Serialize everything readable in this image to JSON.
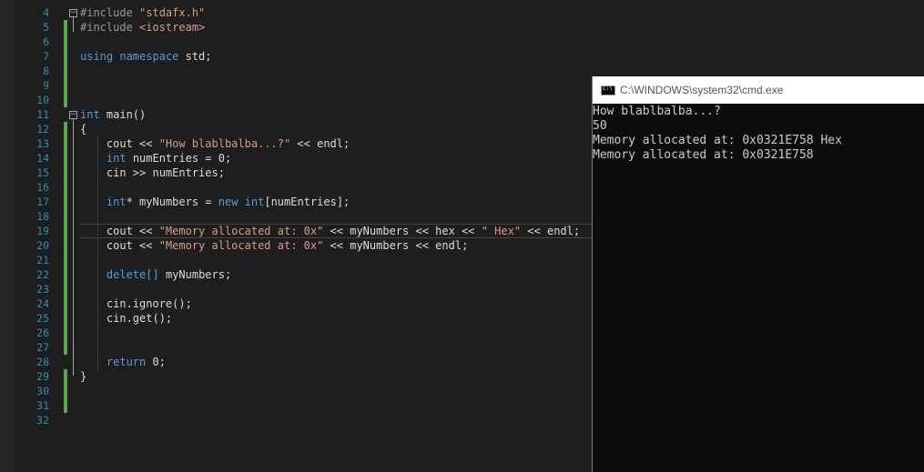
{
  "editor": {
    "line_numbers": [
      "4",
      "5",
      "6",
      "7",
      "8",
      "9",
      "10",
      "11",
      "12",
      "13",
      "14",
      "15",
      "16",
      "17",
      "18",
      "19",
      "20",
      "21",
      "22",
      "23",
      "24",
      "25",
      "26",
      "27",
      "28",
      "29",
      "30",
      "31",
      "32"
    ],
    "lines": [
      [
        {
          "t": "#include ",
          "c": "pp"
        },
        {
          "t": "\"stdafx.h\"",
          "c": "inc"
        }
      ],
      [
        {
          "t": "#include ",
          "c": "pp"
        },
        {
          "t": "<iostream>",
          "c": "inc"
        }
      ],
      [],
      [
        {
          "t": "using ",
          "c": "kw"
        },
        {
          "t": "namespace ",
          "c": "kw"
        },
        {
          "t": "std;",
          "c": "plain"
        }
      ],
      [],
      [],
      [],
      [
        {
          "t": "int ",
          "c": "kw"
        },
        {
          "t": "main()",
          "c": "plain"
        }
      ],
      [
        {
          "t": "{",
          "c": "plain"
        }
      ],
      [
        {
          "t": "    cout << ",
          "c": "plain"
        },
        {
          "t": "\"How blablbalba...?\"",
          "c": "str"
        },
        {
          "t": " << endl;",
          "c": "plain"
        }
      ],
      [
        {
          "t": "    ",
          "c": "plain"
        },
        {
          "t": "int ",
          "c": "kw"
        },
        {
          "t": "numEntries = 0;",
          "c": "plain"
        }
      ],
      [
        {
          "t": "    cin >> numEntries;",
          "c": "plain"
        }
      ],
      [],
      [
        {
          "t": "    ",
          "c": "plain"
        },
        {
          "t": "int",
          "c": "kw"
        },
        {
          "t": "* myNumbers = ",
          "c": "plain"
        },
        {
          "t": "new ",
          "c": "kw"
        },
        {
          "t": "int",
          "c": "kw"
        },
        {
          "t": "[numEntries];",
          "c": "plain"
        }
      ],
      [],
      [
        {
          "t": "    cout << ",
          "c": "plain"
        },
        {
          "t": "\"Memory allocated at: 0x\"",
          "c": "str"
        },
        {
          "t": " << myNumbers << hex << ",
          "c": "plain"
        },
        {
          "t": "\" Hex\"",
          "c": "str"
        },
        {
          "t": " << endl;",
          "c": "plain"
        }
      ],
      [
        {
          "t": "    cout << ",
          "c": "plain"
        },
        {
          "t": "\"Memory allocated at: 0x\"",
          "c": "str"
        },
        {
          "t": " << myNumbers << endl;",
          "c": "plain"
        }
      ],
      [],
      [
        {
          "t": "    ",
          "c": "plain"
        },
        {
          "t": "delete",
          "c": "kw"
        },
        {
          "t": "[] ",
          "c": "kw"
        },
        {
          "t": "myNumbers;",
          "c": "plain"
        }
      ],
      [],
      [
        {
          "t": "    cin.ignore();",
          "c": "plain"
        }
      ],
      [
        {
          "t": "    cin.get();",
          "c": "plain"
        }
      ],
      [],
      [],
      [
        {
          "t": "    ",
          "c": "plain"
        },
        {
          "t": "return ",
          "c": "kw"
        },
        {
          "t": "0;",
          "c": "plain"
        }
      ],
      [
        {
          "t": "}",
          "c": "plain"
        }
      ],
      [],
      [],
      []
    ],
    "fold_markers": [
      "−",
      "−"
    ]
  },
  "console": {
    "title": "C:\\WINDOWS\\system32\\cmd.exe",
    "icon": "cmd-icon",
    "lines": [
      "How blablbalba...?",
      "50",
      "Memory allocated at: 0x0321E758 Hex",
      "Memory allocated at: 0x0321E758"
    ]
  },
  "colors": {
    "background": "#1e1e1e",
    "keyword": "#569cd6",
    "string": "#d69d85",
    "line_number": "#2b91af",
    "change_bar": "#57a64a",
    "console_bg": "#0c0c0c",
    "console_text": "#cccccc"
  }
}
